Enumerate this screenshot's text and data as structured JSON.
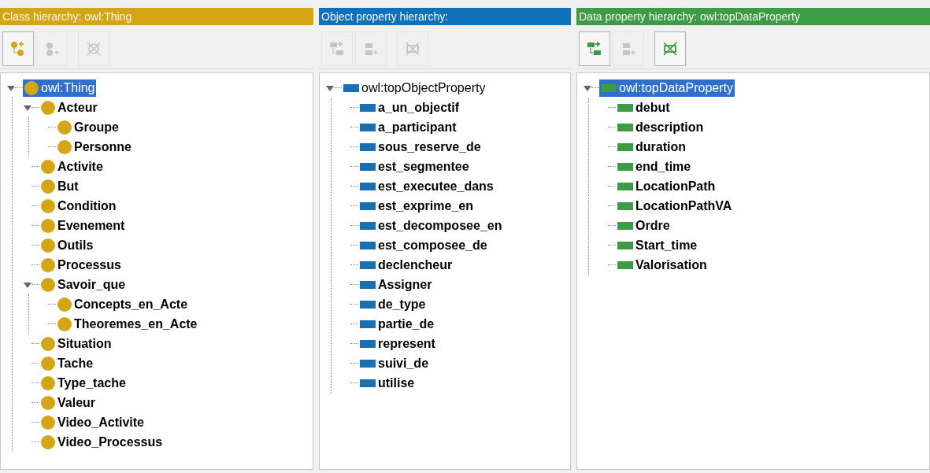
{
  "panels": [
    {
      "kind": "class",
      "header": "Class hierarchy: owl:Thing",
      "tools": [
        {
          "kind": "add-sub",
          "disabled": false
        },
        {
          "kind": "add-sibling",
          "disabled": true
        },
        {
          "kind": "delete",
          "disabled": true
        }
      ],
      "tree": [
        {
          "label": "owl:Thing",
          "selected": true,
          "expanded": true,
          "children": [
            {
              "label": "Acteur",
              "selected": false,
              "expanded": true,
              "children": [
                {
                  "label": "Groupe",
                  "selected": false
                },
                {
                  "label": "Personne",
                  "selected": false
                }
              ]
            },
            {
              "label": "Activite",
              "selected": false
            },
            {
              "label": "But",
              "selected": false
            },
            {
              "label": "Condition",
              "selected": false
            },
            {
              "label": "Evenement",
              "selected": false
            },
            {
              "label": "Outils",
              "selected": false
            },
            {
              "label": "Processus",
              "selected": false
            },
            {
              "label": "Savoir_que",
              "selected": false,
              "expanded": true,
              "children": [
                {
                  "label": "Concepts_en_Acte",
                  "selected": false
                },
                {
                  "label": "Theoremes_en_Acte",
                  "selected": false
                }
              ]
            },
            {
              "label": "Situation",
              "selected": false
            },
            {
              "label": "Tache",
              "selected": false
            },
            {
              "label": "Type_tache",
              "selected": false
            },
            {
              "label": "Valeur",
              "selected": false
            },
            {
              "label": "Video_Activite",
              "selected": false
            },
            {
              "label": "Video_Processus",
              "selected": false
            }
          ]
        }
      ]
    },
    {
      "kind": "object",
      "header": "Object property hierarchy:",
      "tools": [
        {
          "kind": "add-sub",
          "disabled": true
        },
        {
          "kind": "add-sibling",
          "disabled": true
        },
        {
          "kind": "delete",
          "disabled": true
        }
      ],
      "tree": [
        {
          "label": "owl:topObjectProperty",
          "selected": false,
          "expanded": true,
          "children": [
            {
              "label": "a_un_objectif",
              "selected": false
            },
            {
              "label": "a_participant",
              "selected": false
            },
            {
              "label": "sous_reserve_de",
              "selected": false
            },
            {
              "label": "est_segmentee",
              "selected": false
            },
            {
              "label": "est_executee_dans",
              "selected": false
            },
            {
              "label": "est_exprime_en",
              "selected": false
            },
            {
              "label": "est_decomposee_en",
              "selected": false
            },
            {
              "label": "est_composee_de",
              "selected": false
            },
            {
              "label": "declencheur",
              "selected": false
            },
            {
              "label": "Assigner",
              "selected": false
            },
            {
              "label": "de_type",
              "selected": false
            },
            {
              "label": "partie_de",
              "selected": false
            },
            {
              "label": "represent",
              "selected": false
            },
            {
              "label": "suivi_de",
              "selected": false
            },
            {
              "label": "utilise",
              "selected": false
            }
          ]
        }
      ]
    },
    {
      "kind": "data",
      "header": "Data property hierarchy: owl:topDataProperty",
      "tools": [
        {
          "kind": "add-sub",
          "disabled": false
        },
        {
          "kind": "add-sibling",
          "disabled": true
        },
        {
          "kind": "delete",
          "disabled": false
        }
      ],
      "tree": [
        {
          "label": "owl:topDataProperty",
          "selected": true,
          "expanded": true,
          "children": [
            {
              "label": "debut",
              "selected": false
            },
            {
              "label": "description",
              "selected": false
            },
            {
              "label": "duration",
              "selected": false
            },
            {
              "label": "end_time",
              "selected": false
            },
            {
              "label": "LocationPath",
              "selected": false
            },
            {
              "label": "LocationPathVA",
              "selected": false
            },
            {
              "label": "Ordre",
              "selected": false
            },
            {
              "label": "Start_time",
              "selected": false
            },
            {
              "label": "Valorisation",
              "selected": false
            }
          ]
        }
      ]
    }
  ]
}
